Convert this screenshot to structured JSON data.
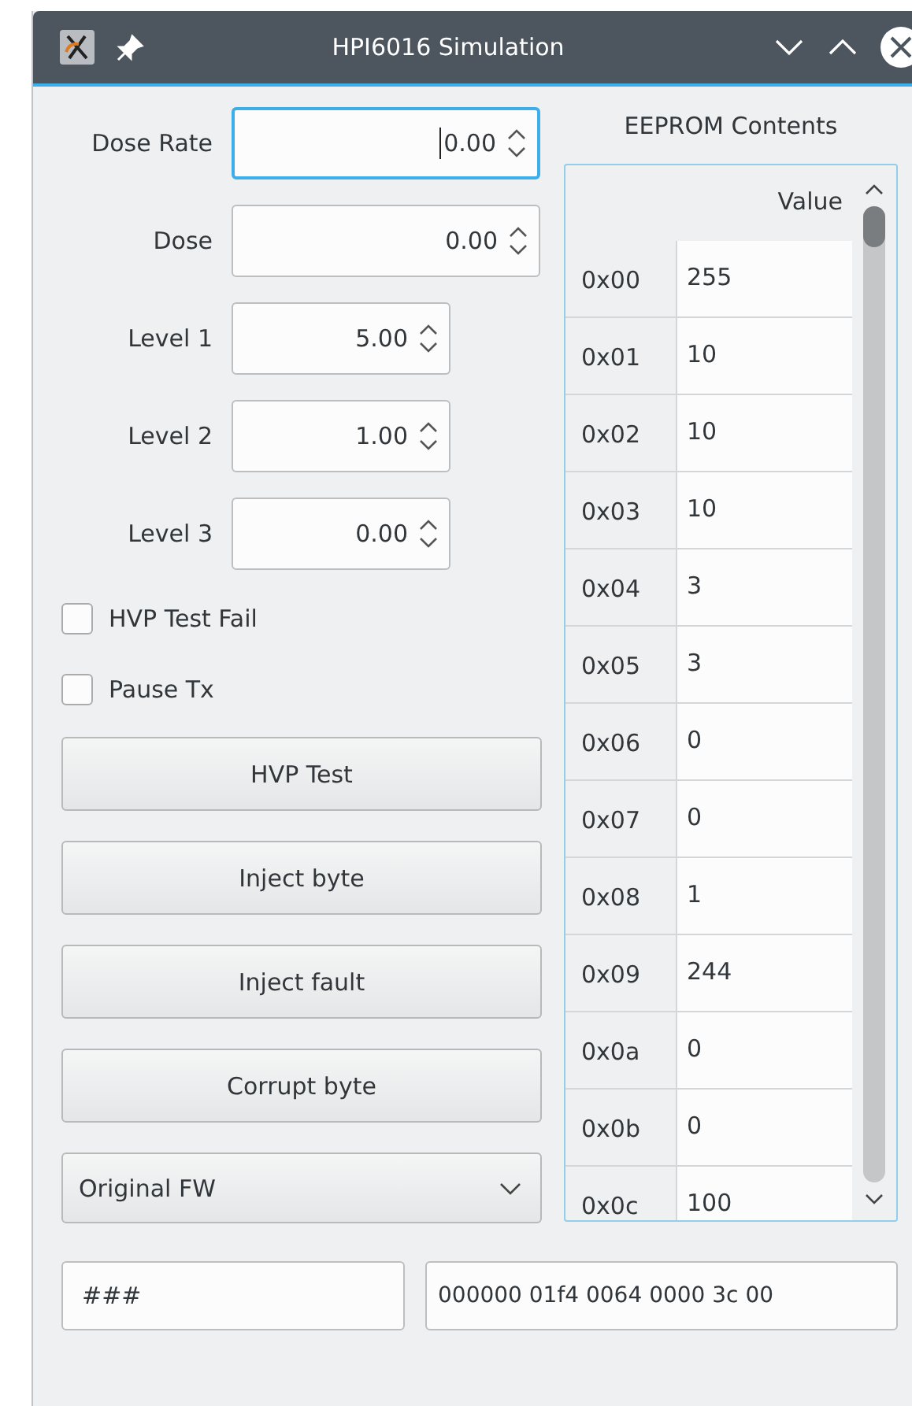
{
  "window": {
    "title": "HPI6016 Simulation"
  },
  "spin_boxes": [
    {
      "label": "Dose Rate",
      "value": "0.00",
      "wide": true,
      "focused": true
    },
    {
      "label": "Dose",
      "value": "0.00",
      "wide": true,
      "focused": false
    },
    {
      "label": "Level 1",
      "value": "5.00",
      "wide": false,
      "focused": false
    },
    {
      "label": "Level 2",
      "value": "1.00",
      "wide": false,
      "focused": false
    },
    {
      "label": "Level 3",
      "value": "0.00",
      "wide": false,
      "focused": false
    }
  ],
  "checkboxes": [
    {
      "label": "HVP Test Fail",
      "checked": false
    },
    {
      "label": "Pause Tx",
      "checked": false
    }
  ],
  "buttons": [
    "HVP Test",
    "Inject byte",
    "Inject fault",
    "Corrupt byte"
  ],
  "firmware_combo": {
    "value": "Original FW"
  },
  "eeprom": {
    "title": "EEPROM Contents",
    "column": "Value",
    "rows": [
      {
        "address": "0x00",
        "value": "255"
      },
      {
        "address": "0x01",
        "value": "10"
      },
      {
        "address": "0x02",
        "value": "10"
      },
      {
        "address": "0x03",
        "value": "10"
      },
      {
        "address": "0x04",
        "value": "3"
      },
      {
        "address": "0x05",
        "value": "3"
      },
      {
        "address": "0x06",
        "value": "0"
      },
      {
        "address": "0x07",
        "value": "0"
      },
      {
        "address": "0x08",
        "value": "1"
      },
      {
        "address": "0x09",
        "value": "244"
      },
      {
        "address": "0x0a",
        "value": "0"
      },
      {
        "address": "0x0b",
        "value": "0"
      },
      {
        "address": "0x0c",
        "value": "100"
      }
    ]
  },
  "status_fields": [
    "###",
    "000000 01f4 0064 0000 3c 00"
  ]
}
